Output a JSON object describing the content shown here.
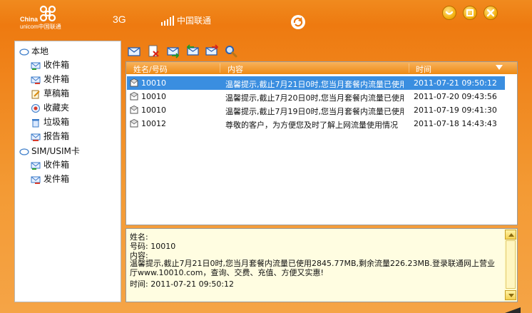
{
  "window": {
    "brand_line1": "China",
    "brand_line2": "unicom中国联通",
    "network_type": "3G",
    "carrier": "中国联通",
    "accent_color": "#ee7a10"
  },
  "sidebar": {
    "groups": [
      {
        "label": "本地",
        "items": [
          {
            "label": "收件箱",
            "icon": "inbox-icon"
          },
          {
            "label": "发件箱",
            "icon": "outbox-icon"
          },
          {
            "label": "草稿箱",
            "icon": "drafts-icon"
          },
          {
            "label": "收藏夹",
            "icon": "favorites-icon"
          },
          {
            "label": "垃圾箱",
            "icon": "trash-icon"
          },
          {
            "label": "报告箱",
            "icon": "report-icon"
          }
        ]
      },
      {
        "label": "SIM/USIM卡",
        "items": [
          {
            "label": "收件箱",
            "icon": "inbox-icon"
          },
          {
            "label": "发件箱",
            "icon": "outbox-icon"
          }
        ]
      }
    ]
  },
  "toolbar": {
    "buttons": [
      "new-message-icon",
      "delete-message-icon",
      "forward-icon",
      "reply-icon",
      "reply-all-icon",
      "search-icon"
    ]
  },
  "list": {
    "columns": [
      "姓名/号码",
      "内容",
      "时间"
    ],
    "rows": [
      {
        "sender": "10010",
        "content": "温馨提示,截止7月21日0时,您当月套餐内流量已使用",
        "time": "2011-07-21 09:50:12",
        "selected": true
      },
      {
        "sender": "10010",
        "content": "温馨提示,截止7月20日0时,您当月套餐内流量已使用",
        "time": "2011-07-20 09:43:56",
        "selected": false
      },
      {
        "sender": "10010",
        "content": "温馨提示,截止7月19日0时,您当月套餐内流量已使用",
        "time": "2011-07-19 09:41:30",
        "selected": false
      },
      {
        "sender": "10012",
        "content": "尊敬的客户，为方便您及时了解上网流量使用情况",
        "time": "2011-07-18 14:43:43",
        "selected": false
      }
    ]
  },
  "detail": {
    "name_line": "姓名:",
    "number_line": "号码: 10010",
    "content_label": "内容:",
    "body": "温馨提示,截止7月21日0时,您当月套餐内流量已使用2845.77MB,剩余流量226.23MB.登录联通网上营业厅www.10010.com，查询、交费、充值、方便又实惠!",
    "time_line": "时间: 2011-07-21 09:50:12"
  }
}
